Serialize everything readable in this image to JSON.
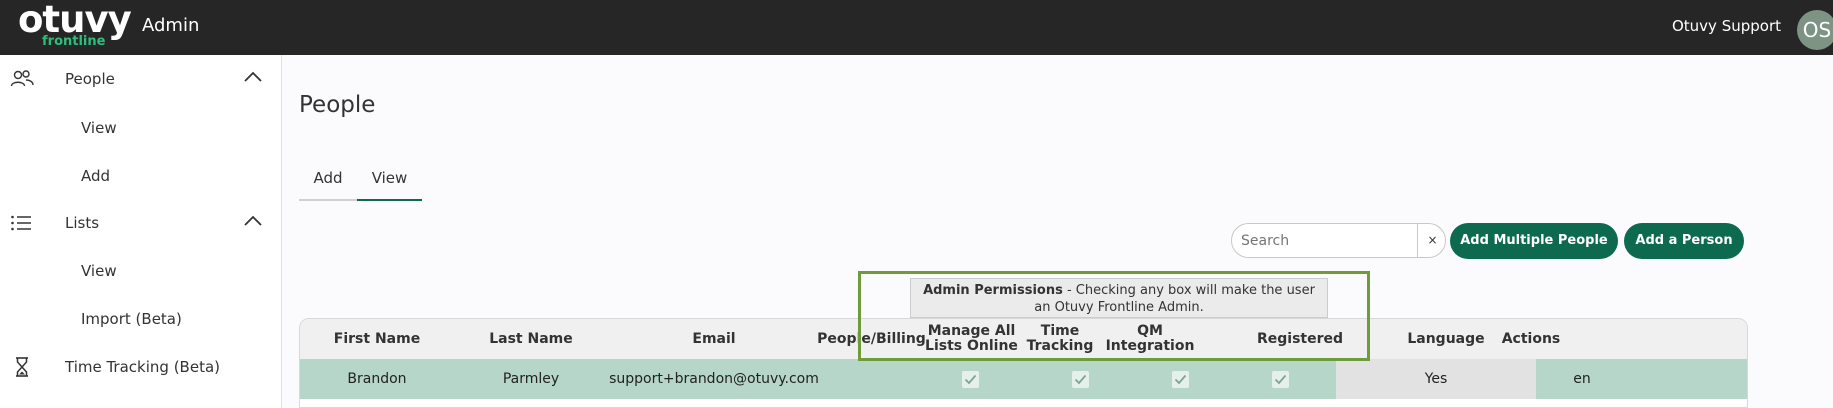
{
  "header": {
    "logo_text": "otuvy",
    "logo_subtext": "frontline",
    "app_title": "Admin",
    "user_name": "Otuvy Support",
    "avatar_initials": "OS"
  },
  "sidebar": {
    "sections": [
      {
        "label": "People",
        "icon": "people-icon",
        "items": [
          "View",
          "Add"
        ]
      },
      {
        "label": "Lists",
        "icon": "list-icon",
        "items": [
          "View",
          "Import (Beta)"
        ]
      },
      {
        "label": "Time Tracking (Beta)",
        "icon": "hourglass-icon",
        "items": []
      }
    ]
  },
  "main": {
    "title": "People",
    "tabs": [
      {
        "label": "Add"
      },
      {
        "label": "View"
      }
    ],
    "search": {
      "placeholder": "Search",
      "value": "",
      "clear": "×"
    },
    "buttons": {
      "add_multiple": "Add Multiple People",
      "add_person": "Add a Person"
    },
    "tooltip": {
      "bold": "Admin Permissions",
      "rest": " - Checking any box will make the user",
      "line2": "an Otuvy Frontline Admin."
    },
    "table": {
      "headers": [
        "First Name",
        "Last Name",
        "Email",
        "People/Billing",
        "Manage All Lists Online",
        "Time Tracking",
        "QM Integration",
        "Registered",
        "Language",
        "Actions"
      ],
      "rows": [
        {
          "first": "Brandon",
          "last": "Parmley",
          "email": "support+brandon@otuvy.com",
          "people_billing": true,
          "manage_lists": true,
          "time_tracking": true,
          "qm": true,
          "registered": "Yes",
          "language": "en",
          "actions": ""
        }
      ]
    }
  },
  "colors": {
    "topbar": "#262626",
    "brand_green": "#0e6a4f",
    "logo_green": "#2dbf7a",
    "row_selected": "#b5d6c8",
    "highlight_border": "#6f9c3a"
  }
}
